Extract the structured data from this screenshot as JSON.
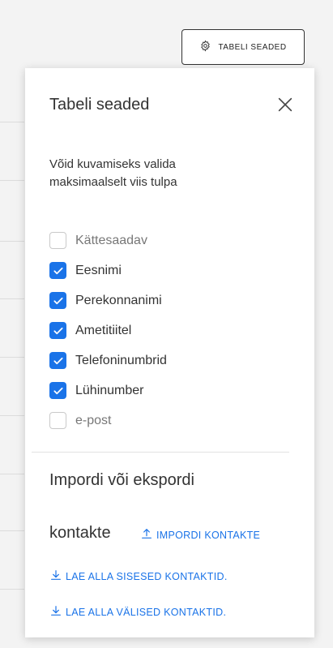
{
  "header": {
    "settings_button_label": "TABELI SEADED",
    "settings_icon": "gear-icon"
  },
  "panel": {
    "title": "Tabeli seaded",
    "close_icon": "close-icon",
    "hint": "Võid kuvamiseks valida maksimaalselt viis tulpa",
    "columns": [
      {
        "label": "Kättesaadav",
        "checked": false
      },
      {
        "label": "Eesnimi",
        "checked": true
      },
      {
        "label": "Perekonnanimi",
        "checked": true
      },
      {
        "label": "Ametitiitel",
        "checked": true
      },
      {
        "label": "Telefoninumbrid",
        "checked": true
      },
      {
        "label": "Lühinumber",
        "checked": true
      },
      {
        "label": "e-post",
        "checked": false
      }
    ],
    "import_title_line1": "Impordi või ekspordi",
    "import_title_line2": "kontakte",
    "import_link": "IMPORDI KONTAKTE",
    "download_internal_link": "LAE ALLA SISESED KONTAKTID.",
    "download_external_link": "LAE ALLA VÄLISED KONTAKTID."
  },
  "colors": {
    "accent": "#1a73e8",
    "panel_bg": "#ffffff",
    "page_bg": "#f3f3f3"
  }
}
